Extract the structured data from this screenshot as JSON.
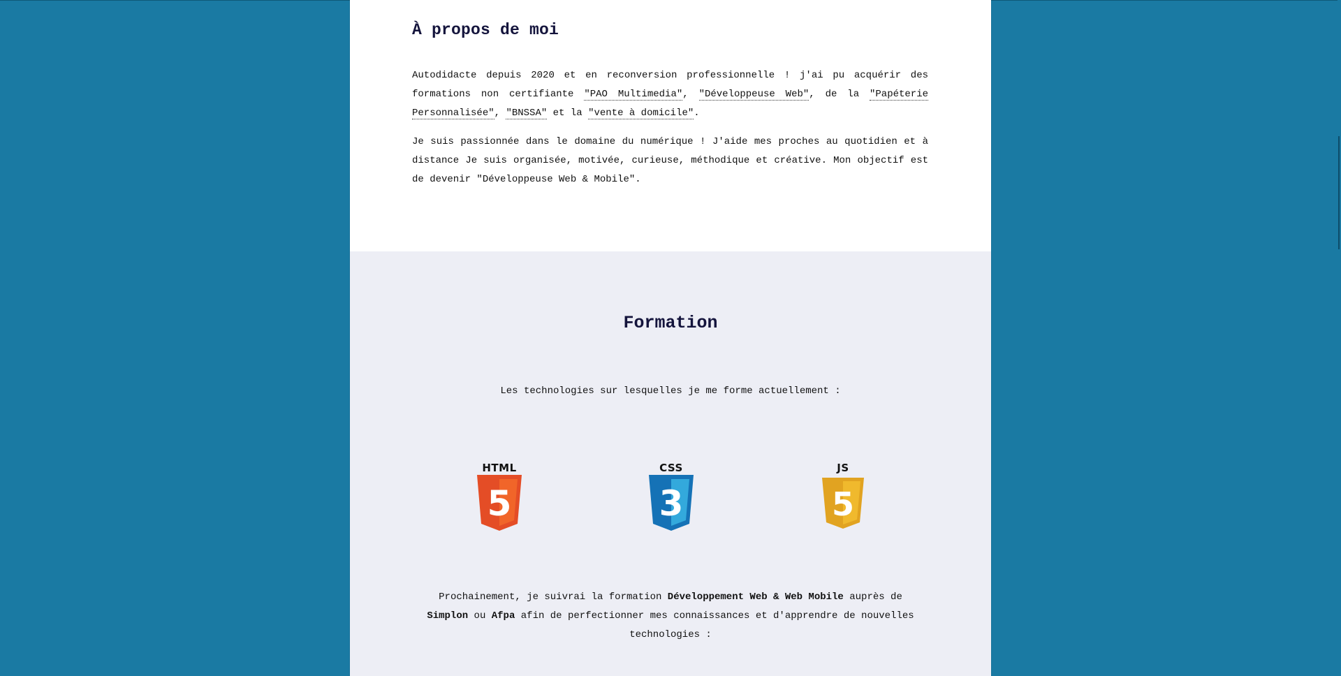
{
  "about": {
    "title": "À propos de moi",
    "p1_text1": "Autodidacte depuis 2020 et en reconversion professionnelle ! j'ai pu acquérir des formations non certifiante ",
    "abbr1": "\"PAO Multimedia\"",
    "p1_sep1": ", ",
    "abbr2": "\"Développeuse Web\"",
    "p1_sep2": ", de la ",
    "abbr3": "\"Papéterie Personnalisée\"",
    "p1_sep3": ", ",
    "abbr4": "\"BNSSA\"",
    "p1_sep4": " et la ",
    "abbr5": "\"vente à domicile\"",
    "p1_end": ".",
    "p2": "Je suis passionnée dans le domaine du numérique ! J'aide mes proches au quotidien et à distance Je suis organisée, motivée, curieuse, méthodique et créative. Mon objectif est de devenir \"Développeuse Web & Mobile\"."
  },
  "formation": {
    "title": "Formation",
    "intro": "Les technologies sur lesquelles je me forme actuellement :",
    "logos": [
      {
        "label": "HTML",
        "glyph": "5",
        "icon": "html5-icon",
        "color_main": "#e44d26",
        "color_light": "#f16529"
      },
      {
        "label": "CSS",
        "glyph": "3",
        "icon": "css3-icon",
        "color_main": "#1572b6",
        "color_light": "#33a9dc"
      },
      {
        "label": "JS",
        "glyph": "5",
        "icon": "js-icon",
        "color_main": "#e1a321",
        "color_light": "#f0b92d"
      }
    ],
    "outro_1": "Prochainement, je suivrai la formation ",
    "outro_b1": "Développement Web & Web Mobile",
    "outro_2": " auprès de ",
    "outro_b2": "Simplon",
    "outro_3": " ou ",
    "outro_b3": "Afpa",
    "outro_4": " afin de perfectionner mes connaissances et d'apprendre de nouvelles technologies :"
  },
  "colors": {
    "background": "#1a7aa3",
    "about_bg": "#ffffff",
    "formation_bg": "#edeef5",
    "heading": "#14143c"
  }
}
